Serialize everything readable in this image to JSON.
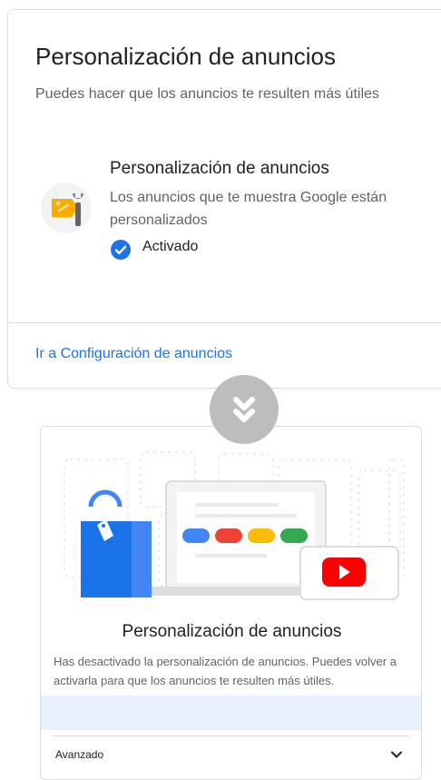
{
  "ads_card": {
    "title": "Personalización de anuncios",
    "subtitle": "Puedes hacer que los anuncios te resulten más útiles",
    "setting": {
      "title": "Personalización de anuncios",
      "description": "Los anuncios que te muestra Google están personalizados",
      "status": "Activado",
      "icon": "ad-settings-icon"
    },
    "link": "Ir a Configuración de anuncios"
  },
  "transition_icon": "double-chevron-down-icon",
  "disabled_card": {
    "title": "Personalización de anuncios",
    "description": "Has desactivado la personalización de anuncios. Puedes volver a activarla para que los anuncios te resulten más útiles.",
    "advanced_label": "Avanzado"
  },
  "colors": {
    "link": "#1a73e8",
    "check": "#1a73e8",
    "banner": "#e8f0fe",
    "google_blue": "#4285f4",
    "google_red": "#ea4335",
    "google_yellow": "#fbbc04",
    "google_green": "#34a853",
    "youtube_red": "#ff0000"
  }
}
